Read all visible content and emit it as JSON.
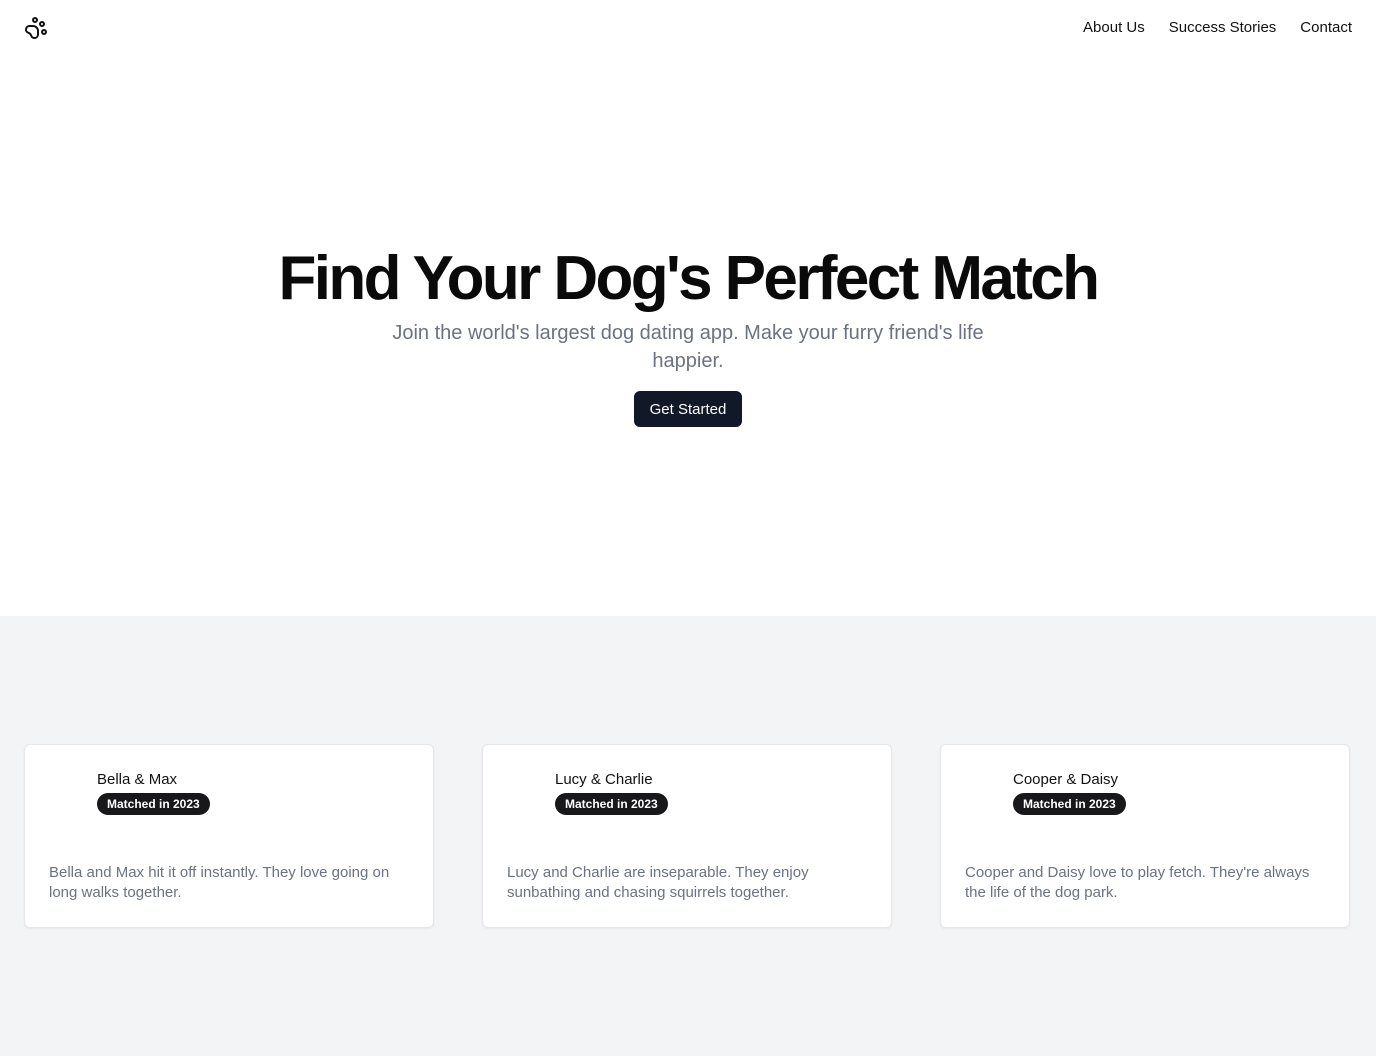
{
  "header": {
    "logo_icon": "paw-icon",
    "nav": [
      {
        "label": "About Us"
      },
      {
        "label": "Success Stories"
      },
      {
        "label": "Contact"
      }
    ]
  },
  "hero": {
    "title": "Find Your Dog's Perfect Match",
    "subtitle": "Join the world's largest dog dating app. Make your furry friend's life happier.",
    "cta_label": "Get Started"
  },
  "stories": [
    {
      "names": "Bella & Max",
      "badge": "Matched in 2023",
      "text": "Bella and Max hit it off instantly. They love going on long walks together."
    },
    {
      "names": "Lucy & Charlie",
      "badge": "Matched in 2023",
      "text": "Lucy and Charlie are inseparable. They enjoy sunbathing and chasing squirrels together."
    },
    {
      "names": "Cooper & Daisy",
      "badge": "Matched in 2023",
      "text": "Cooper and Daisy love to play fetch. They're always the life of the dog park."
    }
  ],
  "colors": {
    "text": "#111111",
    "muted": "#6b7280",
    "button_bg": "#111827",
    "section_bg": "#f2f4f6",
    "badge_bg": "#18181b"
  }
}
